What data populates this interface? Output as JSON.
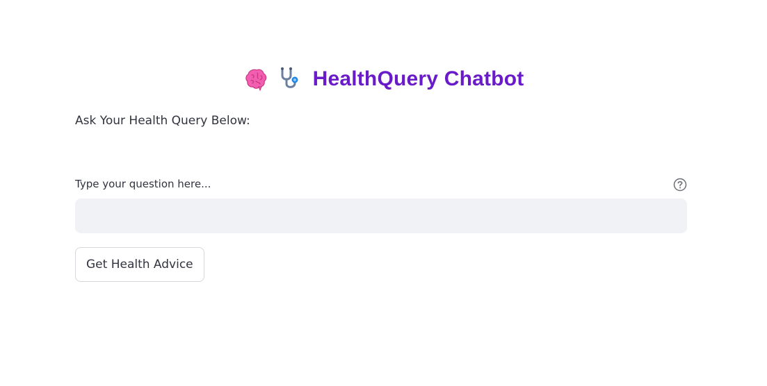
{
  "header": {
    "title": "HealthQuery Chatbot",
    "icons": [
      "brain-icon",
      "stethoscope-icon"
    ],
    "title_color": "#6a1bc9"
  },
  "prompt": {
    "text": "Ask Your Health Query Below:"
  },
  "question_field": {
    "label": "Type your question here...",
    "value": "",
    "placeholder": "",
    "help_icon": "question-circle-icon"
  },
  "action": {
    "button_label": "Get Health Advice"
  },
  "colors": {
    "accent": "#6a1bc9",
    "input_bg": "#f0f2f6",
    "text": "#31333f"
  }
}
